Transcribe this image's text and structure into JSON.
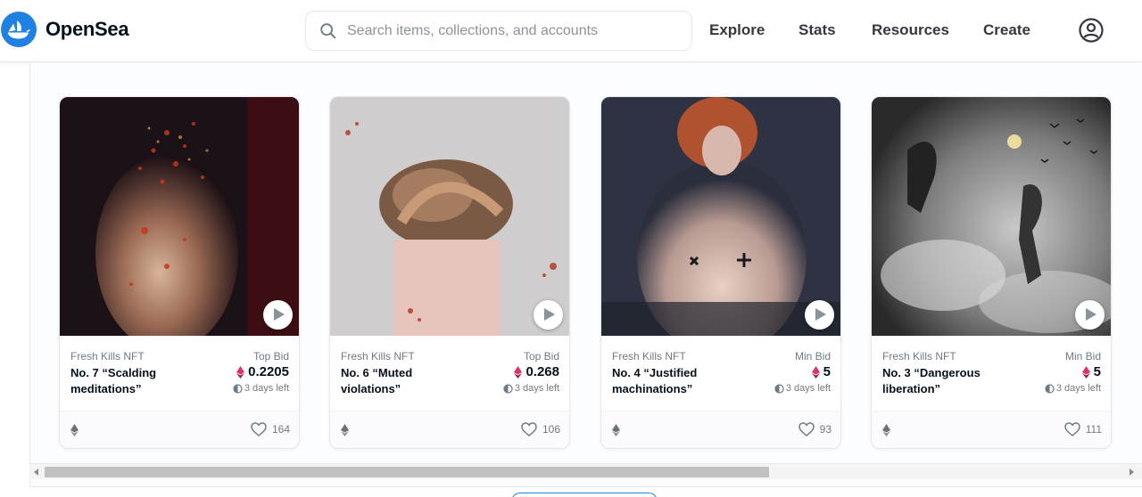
{
  "header": {
    "brand": "OpenSea",
    "search_placeholder": "Search items, collections, and accounts",
    "nav": [
      "Explore",
      "Stats",
      "Resources",
      "Create"
    ]
  },
  "colors": {
    "brand_blue": "#2081e2",
    "eth_pink": "#e1306c",
    "text_primary": "#04111d",
    "text_secondary": "#707a83"
  },
  "cards": [
    {
      "collection": "Fresh Kills NFT",
      "name": "No. 7 “Scalding meditations”",
      "bid_label": "Top Bid",
      "price": "0.2205",
      "time_left": "3 days left",
      "likes": "164"
    },
    {
      "collection": "Fresh Kills NFT",
      "name": "No. 6 “Muted violations”",
      "bid_label": "Top Bid",
      "price": "0.268",
      "time_left": "3 days left",
      "likes": "106"
    },
    {
      "collection": "Fresh Kills NFT",
      "name": "No. 4 “Justified machinations”",
      "bid_label": "Min Bid",
      "price": "5",
      "time_left": "3 days left",
      "likes": "93"
    },
    {
      "collection": "Fresh Kills NFT",
      "name": "No. 3 “Dangerous liberation”",
      "bid_label": "Min Bid",
      "price": "5",
      "time_left": "3 days left",
      "likes": "111"
    }
  ]
}
